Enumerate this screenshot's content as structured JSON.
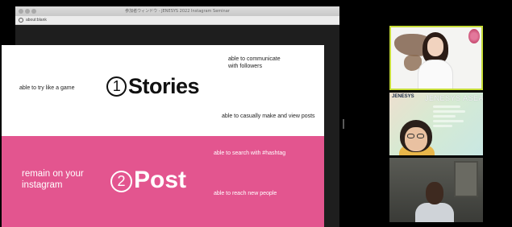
{
  "window": {
    "title": "参加者ウィンドウ - JENESYS 2022 Instagram Seminar",
    "address": "about:blank"
  },
  "slide": {
    "section1": {
      "number": "1",
      "title": "Stories",
      "left_note": "able to try like a game",
      "top_note_line1": "able to communicate",
      "top_note_line2": "with followers",
      "bottom_note": "able to casually make and view posts"
    },
    "section2": {
      "number": "2",
      "title": "Post",
      "left_line1": "remain on your",
      "left_line2": "instagram",
      "top_note": "able to search with #hashtag",
      "bottom_note": "able to reach new people"
    }
  },
  "participants": [
    {
      "id": "participant-1"
    },
    {
      "id": "participant-2",
      "brand": "JENESYS",
      "banner": "JENESYS ASEAN"
    },
    {
      "id": "participant-3"
    }
  ],
  "colors": {
    "slide_pink": "#e3558f",
    "active_speaker_border": "#c6dc38"
  }
}
